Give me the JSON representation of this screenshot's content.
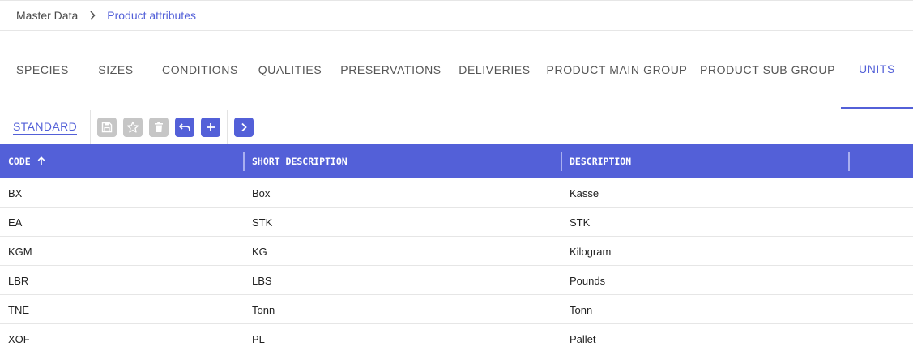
{
  "breadcrumb": {
    "root": "Master Data",
    "current": "Product attributes"
  },
  "tabs": [
    {
      "label": "SPECIES"
    },
    {
      "label": "SIZES"
    },
    {
      "label": "CONDITIONS"
    },
    {
      "label": "QUALITIES"
    },
    {
      "label": "PRESERVATIONS"
    },
    {
      "label": "DELIVERIES"
    },
    {
      "label": "PRODUCT MAIN GROUP"
    },
    {
      "label": "PRODUCT SUB GROUP"
    },
    {
      "label": "UNITS",
      "active": true
    }
  ],
  "toolbar": {
    "view_label": "STANDARD",
    "buttons": [
      {
        "icon": "save-icon",
        "enabled": false
      },
      {
        "icon": "star-icon",
        "enabled": false
      },
      {
        "icon": "trash-icon",
        "enabled": false
      },
      {
        "icon": "undo-icon",
        "enabled": true
      },
      {
        "icon": "plus-icon",
        "enabled": true
      },
      {
        "icon": "chevron-right-icon",
        "enabled": true
      }
    ]
  },
  "grid": {
    "sort": {
      "column": "code",
      "direction": "ascending"
    },
    "columns": {
      "code": "CODE",
      "short_description": "SHORT DESCRIPTION",
      "description": "DESCRIPTION"
    },
    "rows": [
      {
        "code": "BX",
        "short_description": "Box",
        "description": "Kasse"
      },
      {
        "code": "EA",
        "short_description": "STK",
        "description": "STK"
      },
      {
        "code": "KGM",
        "short_description": "KG",
        "description": "Kilogram"
      },
      {
        "code": "LBR",
        "short_description": "LBS",
        "description": "Pounds"
      },
      {
        "code": "TNE",
        "short_description": "Tonn",
        "description": "Tonn"
      },
      {
        "code": "XOF",
        "short_description": "PL",
        "description": "Pallet"
      }
    ]
  },
  "colors": {
    "accent": "#5360d8",
    "disabled_button": "#c6c6c6",
    "header_text": "#ffffff"
  }
}
